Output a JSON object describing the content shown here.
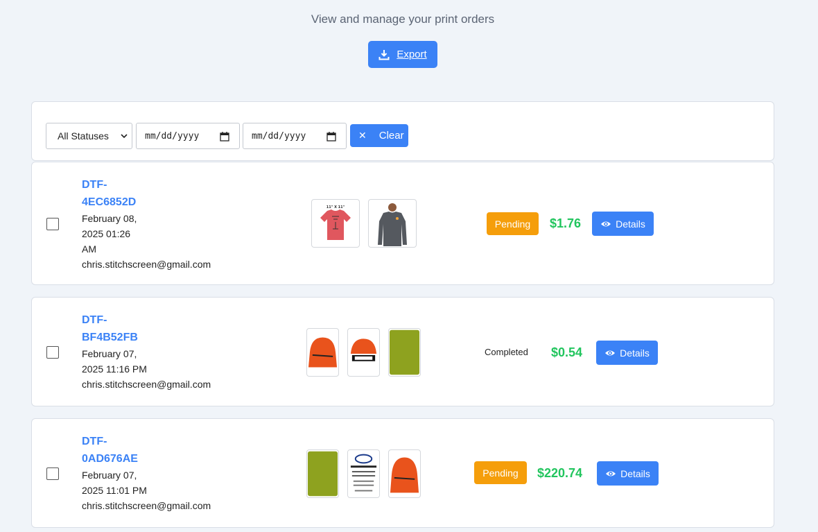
{
  "header": {
    "subtitle": "View and manage your print orders",
    "export_label": "Export"
  },
  "filters": {
    "status_selected": "All Statuses",
    "date_from_placeholder": "mm/dd/yyyy",
    "date_to_placeholder": "mm/dd/yyyy",
    "clear_label": "Clear"
  },
  "orders": [
    {
      "id_line1": "DTF-",
      "id_line2": "4EC6852D",
      "date_lines": [
        "February 08,",
        "2025 01:26",
        "AM"
      ],
      "email": "chris.stitchscreen@gmail.com",
      "thumbnails": [
        "red-tshirt-image",
        "gray-longsleeve-image"
      ],
      "status": "Pending",
      "price": "$1.76",
      "details_label": "Details"
    },
    {
      "id_line1": "DTF-",
      "id_line2": "BF4B52FB",
      "date_lines": [
        "February 07,",
        "2025 11:16 PM"
      ],
      "email": "chris.stitchscreen@gmail.com",
      "thumbnails": [
        "orange-cap-image",
        "orange-cap-back-image",
        "olive-fabric-image"
      ],
      "status": "Completed",
      "price": "$0.54",
      "details_label": "Details"
    },
    {
      "id_line1": "DTF-",
      "id_line2": "0AD676AE",
      "date_lines": [
        "February 07,",
        "2025 11:01 PM"
      ],
      "email": "chris.stitchscreen@gmail.com",
      "thumbnails": [
        "olive-fabric-image",
        "design-engine-logo-image",
        "orange-cap-image"
      ],
      "status": "Pending",
      "price": "$220.74",
      "details_label": "Details"
    }
  ],
  "colors": {
    "accent": "#3b82f6",
    "pending": "#f59e0b",
    "price": "#22c55e",
    "background": "#f0f4f9"
  }
}
